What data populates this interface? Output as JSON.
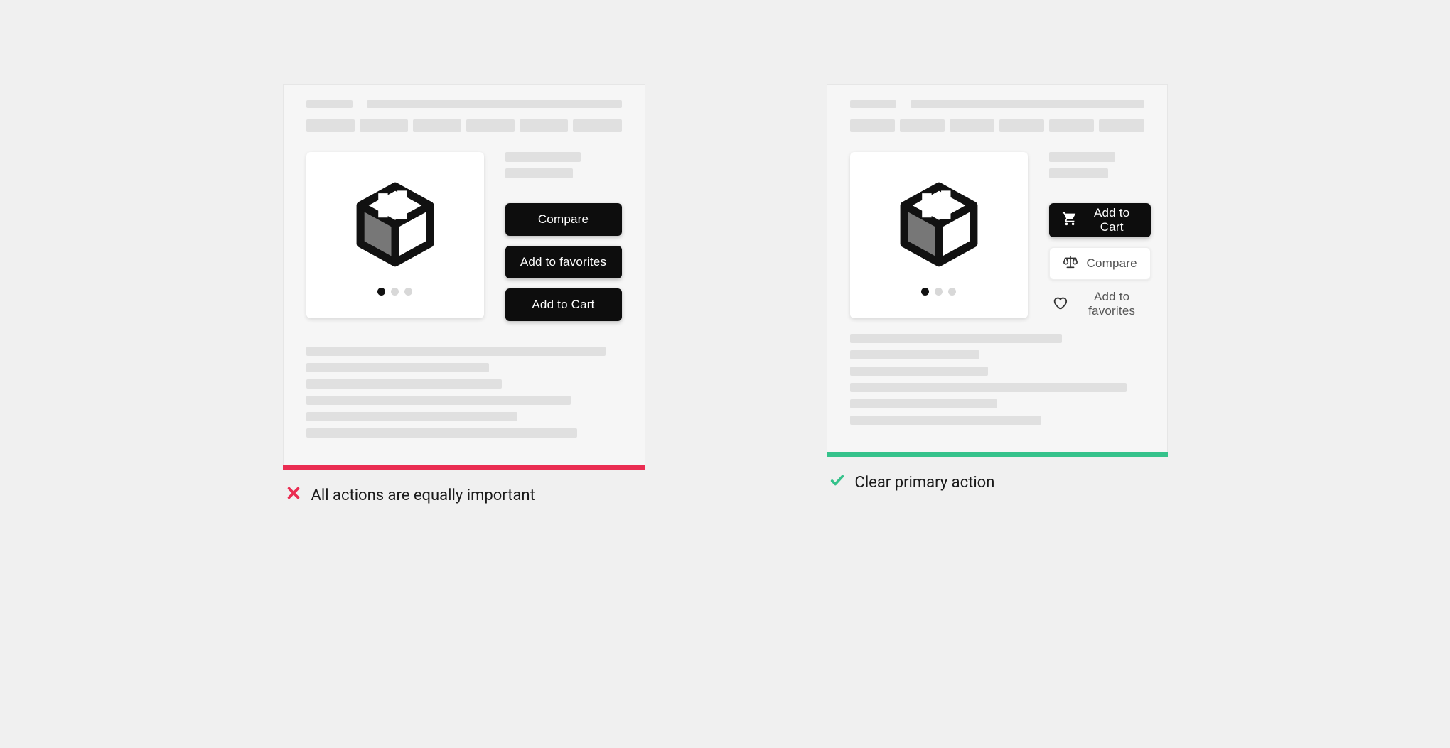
{
  "bad": {
    "actions": {
      "compare": "Compare",
      "favorites": "Add to favorites",
      "cart": "Add to Cart"
    },
    "caption": "All actions are equally important"
  },
  "good": {
    "actions": {
      "cart": "Add to Cart",
      "compare": "Compare",
      "favorites": "Add to favorites"
    },
    "caption": "Clear primary action"
  },
  "colors": {
    "bad": "#ea2d52",
    "good": "#35c28b"
  }
}
